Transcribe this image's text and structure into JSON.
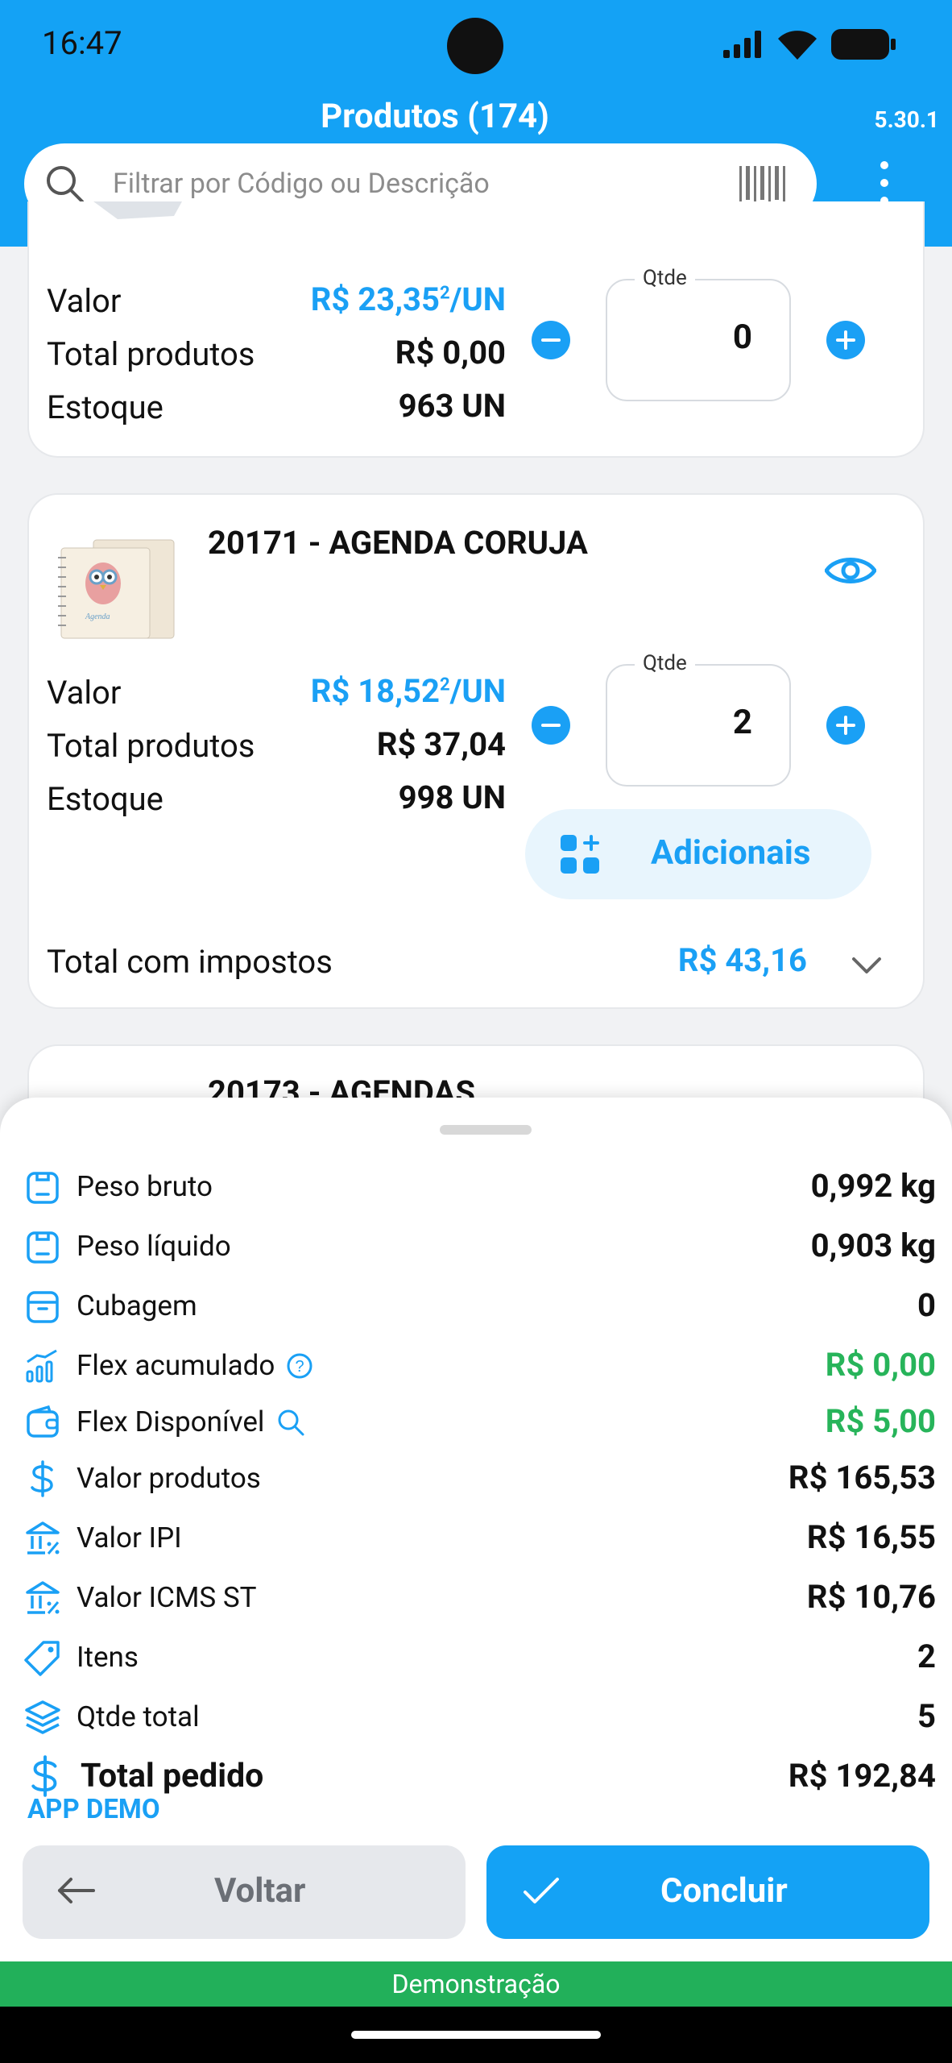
{
  "status_bar": {
    "time": "16:47"
  },
  "header": {
    "title": "Produtos (174)",
    "version": "5.30.1",
    "search_placeholder": "Filtrar por Código ou Descrição"
  },
  "cards": [
    {
      "rows": [
        {
          "label": "Valor",
          "value_main": "R$ 23,35",
          "value_sup": "2",
          "value_unit": "/UN"
        },
        {
          "label": "Total produtos",
          "value": "R$ 0,00"
        },
        {
          "label": "Estoque",
          "value": "963 UN"
        }
      ],
      "qty_label": "Qtde",
      "qty": "0"
    },
    {
      "title": "20171 - AGENDA CORUJA",
      "image_caption": "Agenda",
      "rows": [
        {
          "label": "Valor",
          "value_main": "R$ 18,52",
          "value_sup": "2",
          "value_unit": "/UN"
        },
        {
          "label": "Total produtos",
          "value": "R$ 37,04"
        },
        {
          "label": "Estoque",
          "value": "998 UN"
        }
      ],
      "qty_label": "Qtde",
      "qty": "2",
      "adicionais_label": "Adicionais",
      "total_label": "Total com impostos",
      "total_value": "R$ 43,16"
    },
    {
      "title": "20173 - AGENDAS"
    }
  ],
  "summary": {
    "rows": [
      {
        "label": "Peso bruto",
        "value": "0,992 kg",
        "icon": "weight-icon"
      },
      {
        "label": "Peso líquido",
        "value": "0,903 kg",
        "icon": "weight-icon"
      },
      {
        "label": "Cubagem",
        "value": "0",
        "icon": "box-icon"
      },
      {
        "label": "Flex acumulado",
        "value": "R$ 0,00",
        "icon": "chart-up-icon",
        "value_color": "#27b45a"
      },
      {
        "label": "Flex Disponível",
        "value": "R$ 5,00",
        "icon": "wallet-icon",
        "value_color": "#27b45a"
      },
      {
        "label": "Valor produtos",
        "value": "R$ 165,53",
        "icon": "dollar-icon"
      },
      {
        "label": "Valor IPI",
        "value": "R$ 16,55",
        "icon": "bank-percent-icon"
      },
      {
        "label": "Valor ICMS ST",
        "value": "R$ 10,76",
        "icon": "bank-percent-icon"
      },
      {
        "label": "Itens",
        "value": "2",
        "icon": "tag-icon"
      },
      {
        "label": "Qtde total",
        "value": "5",
        "icon": "layers-icon"
      },
      {
        "label": "Total pedido",
        "value": "R$ 192,84",
        "icon": "dollar-icon"
      }
    ],
    "app_demo": "APP DEMO",
    "back_label": "Voltar",
    "confirm_label": "Concluir"
  },
  "demo_bar": "Demonstração",
  "colors": {
    "primary": "#14a2f5",
    "green": "#27b45a"
  }
}
